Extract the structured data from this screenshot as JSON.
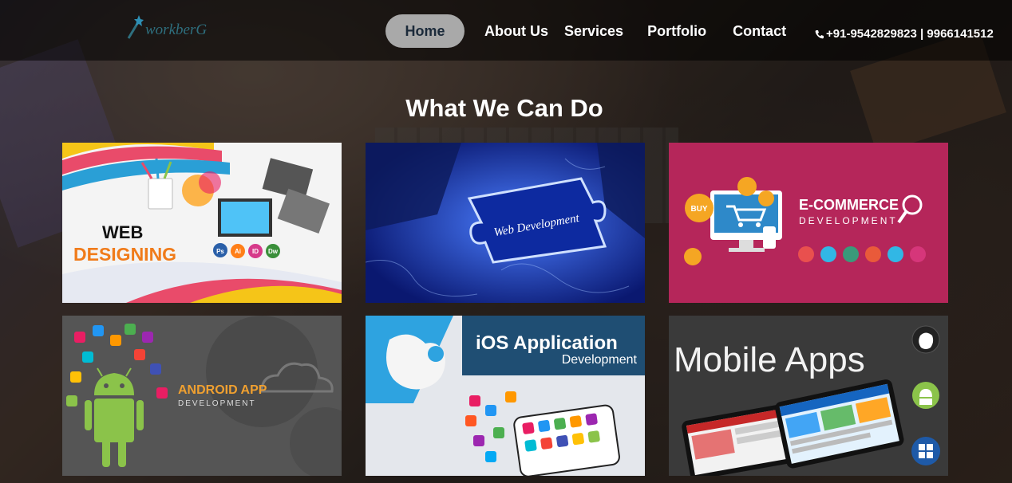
{
  "header": {
    "logo_text": "workberG",
    "nav": {
      "home": "Home",
      "about": "About Us",
      "services": "Services",
      "portfolio": "Portfolio",
      "contact": "Contact"
    },
    "phone": "+91-9542829823 | 9966141512"
  },
  "main": {
    "title": "What We Can Do",
    "cards": [
      {
        "line1": "WEB",
        "line2": "DESIGNING",
        "badges": [
          "Ps",
          "Ai",
          "ID",
          "Dw"
        ]
      },
      {
        "label": "Web Development"
      },
      {
        "line1": "E-COMMERCE",
        "line2": "DEVELOPMENT",
        "badge": "BUY"
      },
      {
        "line1": "ANDROID APP",
        "line2": "DEVELOPMENT"
      },
      {
        "line1": "iOS Application",
        "line2": "Development"
      },
      {
        "line1": "Mobile Apps"
      }
    ]
  },
  "colors": {
    "home_pill": "#a9a9a9",
    "logo": "#2e6f7e",
    "ecommerce_bg": "#b5265a",
    "android_green": "#8bc34a",
    "ios_banner": "#1f4e73"
  }
}
